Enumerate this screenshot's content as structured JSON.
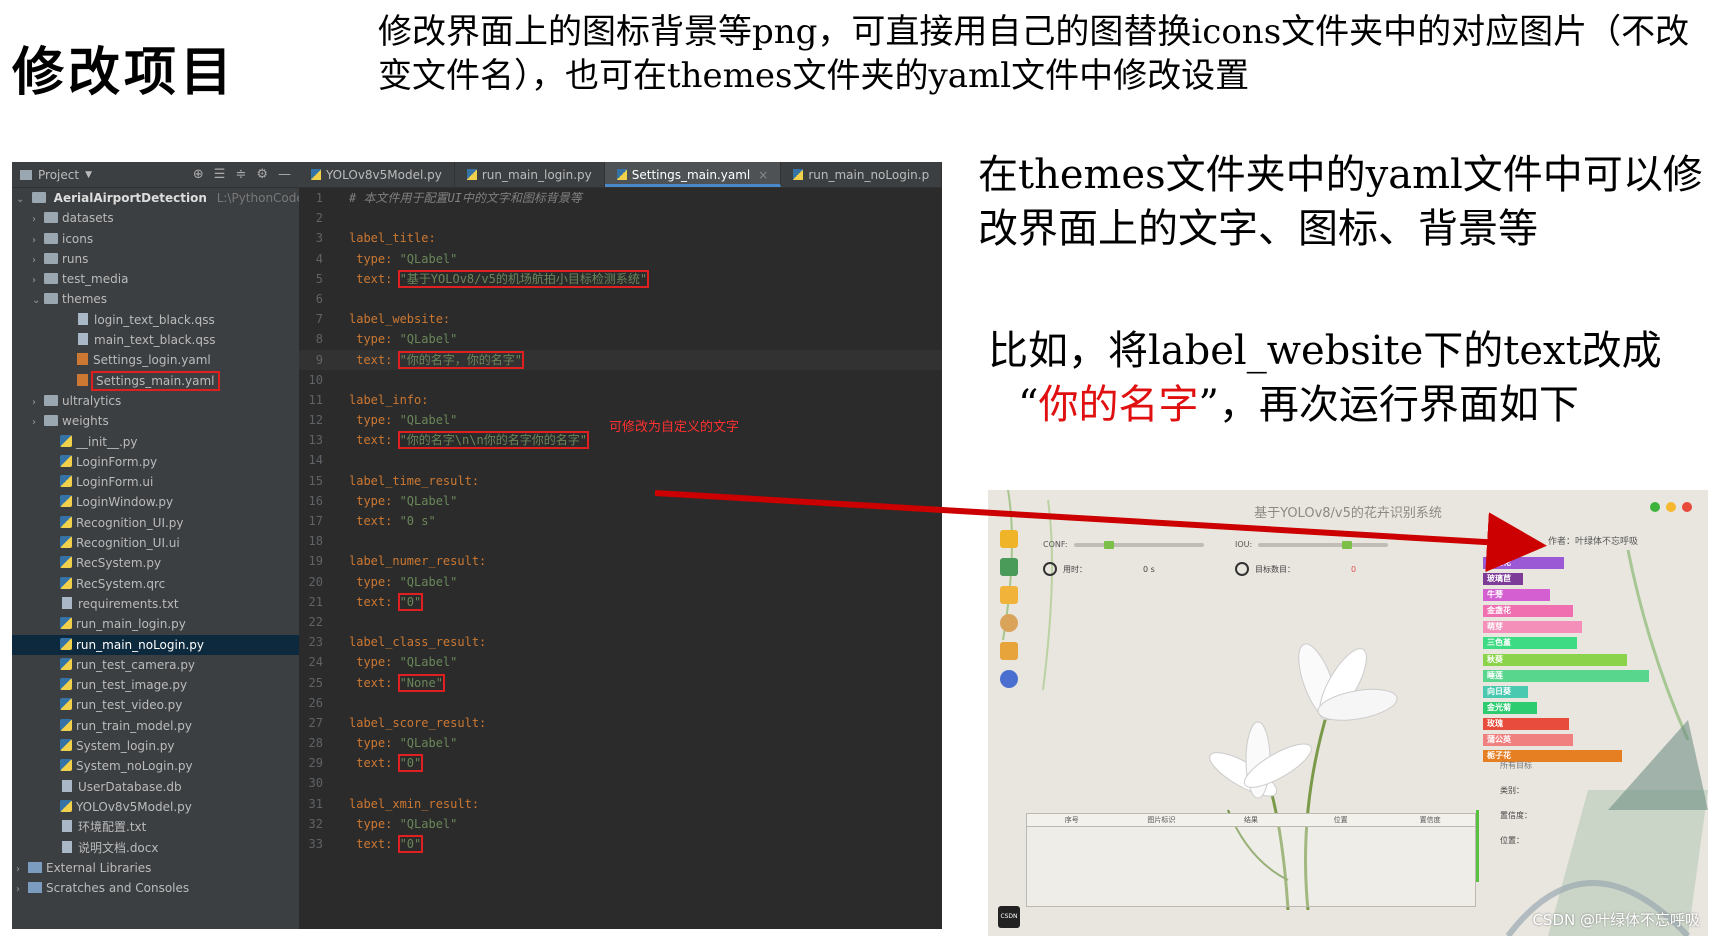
{
  "slide": {
    "title": "修改项目",
    "top_note": "修改界面上的图标背景等png，可直接用自己的图替换icons文件夹中的对应图片（不改变文件名），也可在themes文件夹的yaml文件中修改设置"
  },
  "ide": {
    "project_label": "Project",
    "root": "AerialAirportDetection",
    "root_path": "L:\\PythonCode\\Py",
    "tree": [
      {
        "label": "datasets",
        "type": "folder",
        "arrow": "›",
        "indent": 1
      },
      {
        "label": "icons",
        "type": "folder",
        "arrow": "›",
        "indent": 1
      },
      {
        "label": "runs",
        "type": "folder",
        "arrow": "›",
        "indent": 1
      },
      {
        "label": "test_media",
        "type": "folder",
        "arrow": "›",
        "indent": 1
      },
      {
        "label": "themes",
        "type": "folder",
        "arrow": "⌄",
        "indent": 1
      },
      {
        "label": "login_text_black.qss",
        "type": "file",
        "arrow": "",
        "indent": 3
      },
      {
        "label": "main_text_black.qss",
        "type": "file",
        "arrow": "",
        "indent": 3
      },
      {
        "label": "Settings_login.yaml",
        "type": "yaml",
        "arrow": "",
        "indent": 3
      },
      {
        "label": "Settings_main.yaml",
        "type": "yaml",
        "arrow": "",
        "indent": 3,
        "boxed": true
      },
      {
        "label": "ultralytics",
        "type": "folder",
        "arrow": "›",
        "indent": 1
      },
      {
        "label": "weights",
        "type": "folder",
        "arrow": "›",
        "indent": 1
      },
      {
        "label": "__init__.py",
        "type": "py",
        "arrow": "",
        "indent": 2
      },
      {
        "label": "LoginForm.py",
        "type": "py",
        "arrow": "",
        "indent": 2
      },
      {
        "label": "LoginForm.ui",
        "type": "py",
        "arrow": "",
        "indent": 2
      },
      {
        "label": "LoginWindow.py",
        "type": "py",
        "arrow": "",
        "indent": 2
      },
      {
        "label": "Recognition_UI.py",
        "type": "py",
        "arrow": "",
        "indent": 2
      },
      {
        "label": "Recognition_UI.ui",
        "type": "py",
        "arrow": "",
        "indent": 2
      },
      {
        "label": "RecSystem.py",
        "type": "py",
        "arrow": "",
        "indent": 2
      },
      {
        "label": "RecSystem.qrc",
        "type": "py",
        "arrow": "",
        "indent": 2
      },
      {
        "label": "requirements.txt",
        "type": "file",
        "arrow": "",
        "indent": 2
      },
      {
        "label": "run_main_login.py",
        "type": "py",
        "arrow": "",
        "indent": 2
      },
      {
        "label": "run_main_noLogin.py",
        "type": "py",
        "arrow": "",
        "indent": 2,
        "selected": true
      },
      {
        "label": "run_test_camera.py",
        "type": "py",
        "arrow": "",
        "indent": 2
      },
      {
        "label": "run_test_image.py",
        "type": "py",
        "arrow": "",
        "indent": 2
      },
      {
        "label": "run_test_video.py",
        "type": "py",
        "arrow": "",
        "indent": 2
      },
      {
        "label": "run_train_model.py",
        "type": "py",
        "arrow": "",
        "indent": 2
      },
      {
        "label": "System_login.py",
        "type": "py",
        "arrow": "",
        "indent": 2
      },
      {
        "label": "System_noLogin.py",
        "type": "py",
        "arrow": "",
        "indent": 2
      },
      {
        "label": "UserDatabase.db",
        "type": "file",
        "arrow": "",
        "indent": 2
      },
      {
        "label": "YOLOv8v5Model.py",
        "type": "py",
        "arrow": "",
        "indent": 2
      },
      {
        "label": "环境配置.txt",
        "type": "file",
        "arrow": "",
        "indent": 2
      },
      {
        "label": "说明文档.docx",
        "type": "file",
        "arrow": "",
        "indent": 2
      },
      {
        "label": "External Libraries",
        "type": "lib",
        "arrow": "›",
        "indent": 0
      },
      {
        "label": "Scratches and Consoles",
        "type": "lib",
        "arrow": "›",
        "indent": 0
      }
    ],
    "tabs": [
      {
        "label": "YOLOv8v5Model.py",
        "active": false
      },
      {
        "label": "run_main_login.py",
        "active": false
      },
      {
        "label": "Settings_main.yaml",
        "active": true
      },
      {
        "label": "run_main_noLogin.p",
        "active": false
      }
    ],
    "code": [
      {
        "n": "1",
        "parts": [
          [
            "c-comment",
            "# 本文件用于配置UI中的文字和图标背景等"
          ]
        ]
      },
      {
        "n": "2",
        "parts": []
      },
      {
        "n": "3",
        "parts": [
          [
            "c-key",
            "label_title:"
          ]
        ]
      },
      {
        "n": "4",
        "parts": [
          [
            "c-key",
            "  type: "
          ],
          [
            "c-str",
            "\"QLabel\""
          ]
        ]
      },
      {
        "n": "5",
        "parts": [
          [
            "c-key",
            "  text: "
          ],
          [
            "c-str box",
            "\"基于YOLOv8/v5的机场航拍小目标检测系统\""
          ]
        ]
      },
      {
        "n": "6",
        "parts": []
      },
      {
        "n": "7",
        "parts": [
          [
            "c-key",
            "label_website:"
          ]
        ]
      },
      {
        "n": "8",
        "parts": [
          [
            "c-key",
            "  type: "
          ],
          [
            "c-str",
            "\"QLabel\""
          ]
        ]
      },
      {
        "n": "9",
        "parts": [
          [
            "c-key",
            "  text: "
          ],
          [
            "c-str box",
            "\"你的名字，你的名字\""
          ]
        ],
        "current": true
      },
      {
        "n": "10",
        "parts": []
      },
      {
        "n": "11",
        "parts": [
          [
            "c-key",
            "label_info:"
          ]
        ]
      },
      {
        "n": "12",
        "parts": [
          [
            "c-key",
            "  type: "
          ],
          [
            "c-str",
            "\"QLabel\""
          ]
        ]
      },
      {
        "n": "13",
        "parts": [
          [
            "c-key",
            "  text: "
          ],
          [
            "c-str box",
            "\"你的名字\\n\\n你的名字你的名字\""
          ]
        ]
      },
      {
        "n": "14",
        "parts": []
      },
      {
        "n": "15",
        "parts": [
          [
            "c-key",
            "label_time_result:"
          ]
        ]
      },
      {
        "n": "16",
        "parts": [
          [
            "c-key",
            "  type: "
          ],
          [
            "c-str",
            "\"QLabel\""
          ]
        ]
      },
      {
        "n": "17",
        "parts": [
          [
            "c-key",
            "  text: "
          ],
          [
            "c-str",
            "\"0 s\""
          ]
        ]
      },
      {
        "n": "18",
        "parts": []
      },
      {
        "n": "19",
        "parts": [
          [
            "c-key",
            "label_numer_result:"
          ]
        ]
      },
      {
        "n": "20",
        "parts": [
          [
            "c-key",
            "  type: "
          ],
          [
            "c-str",
            "\"QLabel\""
          ]
        ]
      },
      {
        "n": "21",
        "parts": [
          [
            "c-key",
            "  text: "
          ],
          [
            "c-str box",
            "\"0\""
          ]
        ]
      },
      {
        "n": "22",
        "parts": []
      },
      {
        "n": "23",
        "parts": [
          [
            "c-key",
            "label_class_result:"
          ]
        ]
      },
      {
        "n": "24",
        "parts": [
          [
            "c-key",
            "  type: "
          ],
          [
            "c-str",
            "\"QLabel\""
          ]
        ]
      },
      {
        "n": "25",
        "parts": [
          [
            "c-key",
            "  text: "
          ],
          [
            "c-str box",
            "\"None\""
          ]
        ]
      },
      {
        "n": "26",
        "parts": []
      },
      {
        "n": "27",
        "parts": [
          [
            "c-key",
            "label_score_result:"
          ]
        ]
      },
      {
        "n": "28",
        "parts": [
          [
            "c-key",
            "  type: "
          ],
          [
            "c-str",
            "\"QLabel\""
          ]
        ]
      },
      {
        "n": "29",
        "parts": [
          [
            "c-key",
            "  text: "
          ],
          [
            "c-str box",
            "\"0\""
          ]
        ]
      },
      {
        "n": "30",
        "parts": []
      },
      {
        "n": "31",
        "parts": [
          [
            "c-key",
            "label_xmin_result:"
          ]
        ]
      },
      {
        "n": "32",
        "parts": [
          [
            "c-key",
            "  type: "
          ],
          [
            "c-str",
            "\"QLabel\""
          ]
        ]
      },
      {
        "n": "33",
        "parts": [
          [
            "c-key",
            "  text: "
          ],
          [
            "c-str box",
            "\"0\""
          ]
        ]
      }
    ],
    "annotation": "可修改为自定义的文字"
  },
  "notes": {
    "note1": "在themes文件夹中的yaml文件中可以修改界面上的文字、图标、背景等",
    "note2_a": "比如，将label_website下的text改成",
    "note2_quote_open": "“",
    "note2_red": "你的名字",
    "note2_quote_close": "”",
    "note2_b": "，再次运行界面如下"
  },
  "app": {
    "title": "基于YOLOv8/v5的花卉识别系统",
    "author": "作者：叶绿体不忘呼吸",
    "conf_label": "CONF:",
    "iou_label": "IOU:",
    "conf_value": 0.25,
    "iou_value": 0.7,
    "time_label": "用时：",
    "time_value": "0 s",
    "count_label": "目标数目：",
    "count_value": "0",
    "class_label": "类别：",
    "score_label": "置信度：",
    "position_label": "位置：",
    "all_targets": "所有目标",
    "table_headers": [
      "序号",
      "图片标识",
      "结果",
      "位置",
      "置信度"
    ],
    "bars": [
      {
        "label": "大葱花",
        "value": 0.45,
        "color": "#9b59d6"
      },
      {
        "label": "玻璃苣",
        "value": 0.22,
        "color": "#7d3c98"
      },
      {
        "label": "牛蒡",
        "value": 0.37,
        "color": "#d35fd0"
      },
      {
        "label": "金盏花",
        "value": 0.5,
        "color": "#ef6fb0"
      },
      {
        "label": "萌芽",
        "value": 0.55,
        "color": "#f38fb8"
      },
      {
        "label": "三色堇",
        "value": 0.52,
        "color": "#3ddc84"
      },
      {
        "label": "秋葵",
        "value": 0.8,
        "color": "#8bd34a"
      },
      {
        "label": "睡莲",
        "value": 0.92,
        "color": "#58d68d"
      },
      {
        "label": "向日葵",
        "value": 0.25,
        "color": "#48c9b0"
      },
      {
        "label": "金光菊",
        "value": 0.3,
        "color": "#2ecc71"
      },
      {
        "label": "玫瑰",
        "value": 0.48,
        "color": "#e74c3c"
      },
      {
        "label": "蒲公英",
        "value": 0.5,
        "color": "#f08080"
      },
      {
        "label": "栀子花",
        "value": 0.77,
        "color": "#e67e22"
      }
    ],
    "watermark": "CSDN @叶绿体不忘呼吸",
    "badge": "CSDN"
  }
}
